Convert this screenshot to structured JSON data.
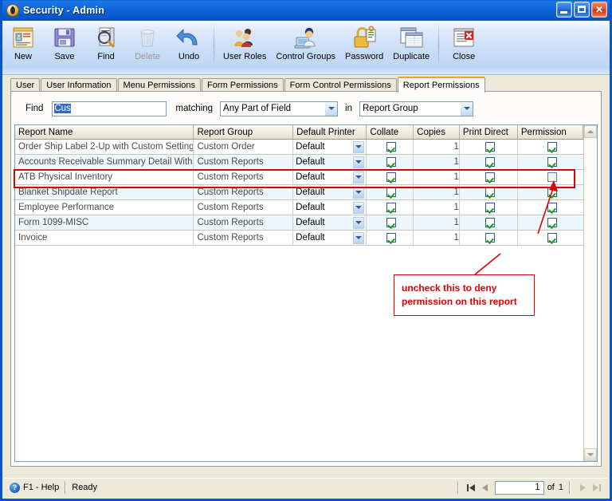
{
  "window": {
    "title": "Security - Admin",
    "app_icon": "security-shield-icon",
    "minimize_label": "Minimize",
    "maximize_label": "Maximize",
    "close_label": "Close"
  },
  "toolbar": {
    "items": [
      {
        "label": "New",
        "icon": "new-record-icon",
        "enabled": true
      },
      {
        "label": "Save",
        "icon": "floppy-save-icon",
        "enabled": true
      },
      {
        "label": "Find",
        "icon": "magnifier-find-icon",
        "enabled": true
      },
      {
        "label": "Delete",
        "icon": "trash-delete-icon",
        "enabled": false
      },
      {
        "label": "Undo",
        "icon": "undo-arrow-icon",
        "enabled": true
      },
      {
        "label": "User Roles",
        "icon": "users-group-icon",
        "enabled": true
      },
      {
        "label": "Control Groups",
        "icon": "user-computer-icon",
        "enabled": true
      },
      {
        "label": "Password",
        "icon": "padlock-key-icon",
        "enabled": true
      },
      {
        "label": "Duplicate",
        "icon": "duplicate-pages-icon",
        "enabled": true
      },
      {
        "label": "Close",
        "icon": "close-document-icon",
        "enabled": true
      }
    ]
  },
  "tabs": [
    {
      "label": "User",
      "active": false
    },
    {
      "label": "User Information",
      "active": false
    },
    {
      "label": "Menu Permissions",
      "active": false
    },
    {
      "label": "Form Permissions",
      "active": false
    },
    {
      "label": "Form Control Permissions",
      "active": false
    },
    {
      "label": "Report Permissions",
      "active": true
    }
  ],
  "find_bar": {
    "find_label": "Find",
    "find_value": "Cus",
    "matching_label": "matching",
    "matching_value": "Any Part of Field",
    "in_label": "in",
    "in_value": "Report Group"
  },
  "grid": {
    "columns": [
      "Report Name",
      "Report Group",
      "Default Printer",
      "Collate",
      "Copies",
      "Print Direct",
      "Permission"
    ],
    "rows": [
      {
        "name": "Order Ship Label 2-Up with Custom Setting",
        "group": "Custom Order",
        "printer": "Default",
        "collate": true,
        "copies": "1",
        "print_direct": true,
        "permission": true,
        "highlighted": false
      },
      {
        "name": "Accounts Receivable Summary Detail With",
        "group": "Custom Reports",
        "printer": "Default",
        "collate": true,
        "copies": "1",
        "print_direct": true,
        "permission": true,
        "highlighted": false
      },
      {
        "name": "ATB Physical Inventory",
        "group": "Custom Reports",
        "printer": "Default",
        "collate": true,
        "copies": "1",
        "print_direct": true,
        "permission": false,
        "highlighted": true
      },
      {
        "name": "Blanket Shipdate Report",
        "group": "Custom Reports",
        "printer": "Default",
        "collate": true,
        "copies": "1",
        "print_direct": true,
        "permission": true,
        "highlighted": false
      },
      {
        "name": "Employee Performance",
        "group": "Custom Reports",
        "printer": "Default",
        "collate": true,
        "copies": "1",
        "print_direct": true,
        "permission": true,
        "highlighted": false
      },
      {
        "name": "Form 1099-MISC",
        "group": "Custom Reports",
        "printer": "Default",
        "collate": true,
        "copies": "1",
        "print_direct": true,
        "permission": true,
        "highlighted": false
      },
      {
        "name": "Invoice",
        "group": "Custom Reports",
        "printer": "Default",
        "collate": true,
        "copies": "1",
        "print_direct": true,
        "permission": true,
        "highlighted": false
      }
    ]
  },
  "annotation": {
    "callout_line1": "uncheck this to deny",
    "callout_line2": "permission on this report",
    "color": "#e00000"
  },
  "status_bar": {
    "help_icon": "help-question-icon",
    "help_label": "F1 - Help",
    "status": "Ready",
    "nav_first": "first-record-icon",
    "nav_prev": "previous-record-icon",
    "page_value": "1",
    "of_label": "of",
    "page_total": "1",
    "nav_next": "next-record-icon",
    "nav_last": "last-record-icon"
  },
  "colors": {
    "titlebar_blue": "#0f67dd",
    "accent_orange": "#f5a21c",
    "annotation_red": "#e00000",
    "row_alt": "#eef7fb",
    "panel_bg": "#ece9d8"
  }
}
